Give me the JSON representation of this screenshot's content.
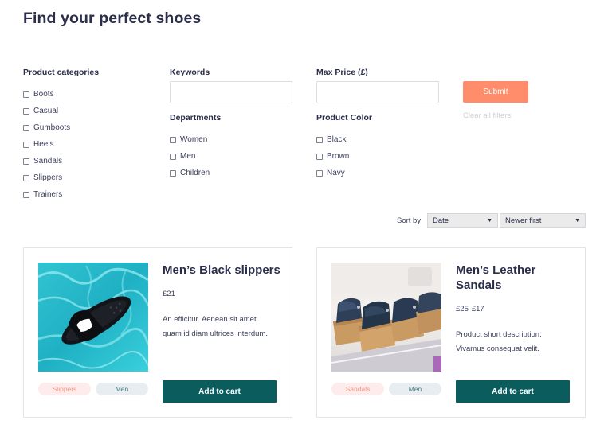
{
  "page": {
    "title": "Find your perfect shoes"
  },
  "filters": {
    "categories": {
      "label": "Product categories",
      "items": [
        "Boots",
        "Casual",
        "Gumboots",
        "Heels",
        "Sandals",
        "Slippers",
        "Trainers"
      ]
    },
    "keywords": {
      "label": "Keywords",
      "value": "",
      "placeholder": ""
    },
    "departments": {
      "label": "Departments",
      "items": [
        "Women",
        "Men",
        "Children"
      ]
    },
    "max_price": {
      "label": "Max Price (£)",
      "value": "",
      "placeholder": ""
    },
    "colors": {
      "label": "Product Color",
      "items": [
        "Black",
        "Brown",
        "Navy"
      ]
    },
    "submit_label": "Submit",
    "clear_label": "Clear all filters"
  },
  "sort": {
    "label": "Sort by",
    "field": "Date",
    "order": "Newer first"
  },
  "products": [
    {
      "title": "Men’s Black slippers",
      "old_price": "",
      "price": "£21",
      "description": "An efficitur. Aenean sit amet quam id diam ultrices interdum.",
      "category_tag": "Slippers",
      "department_tag": "Men",
      "cart_label": "Add to cart"
    },
    {
      "title": "Men’s Leather Sandals",
      "old_price": "£25",
      "price": "£17",
      "description": "Product short description. Vivamus consequat velit.",
      "category_tag": "Sandals",
      "department_tag": "Men",
      "cart_label": "Add to cart"
    }
  ],
  "colors": {
    "submit": "#ff8d6c",
    "cart_button": "#0b5c5d",
    "tag_category_bg": "#fdeceb",
    "tag_department_bg": "#e7edf0",
    "title_text": "#2b2e4a"
  }
}
